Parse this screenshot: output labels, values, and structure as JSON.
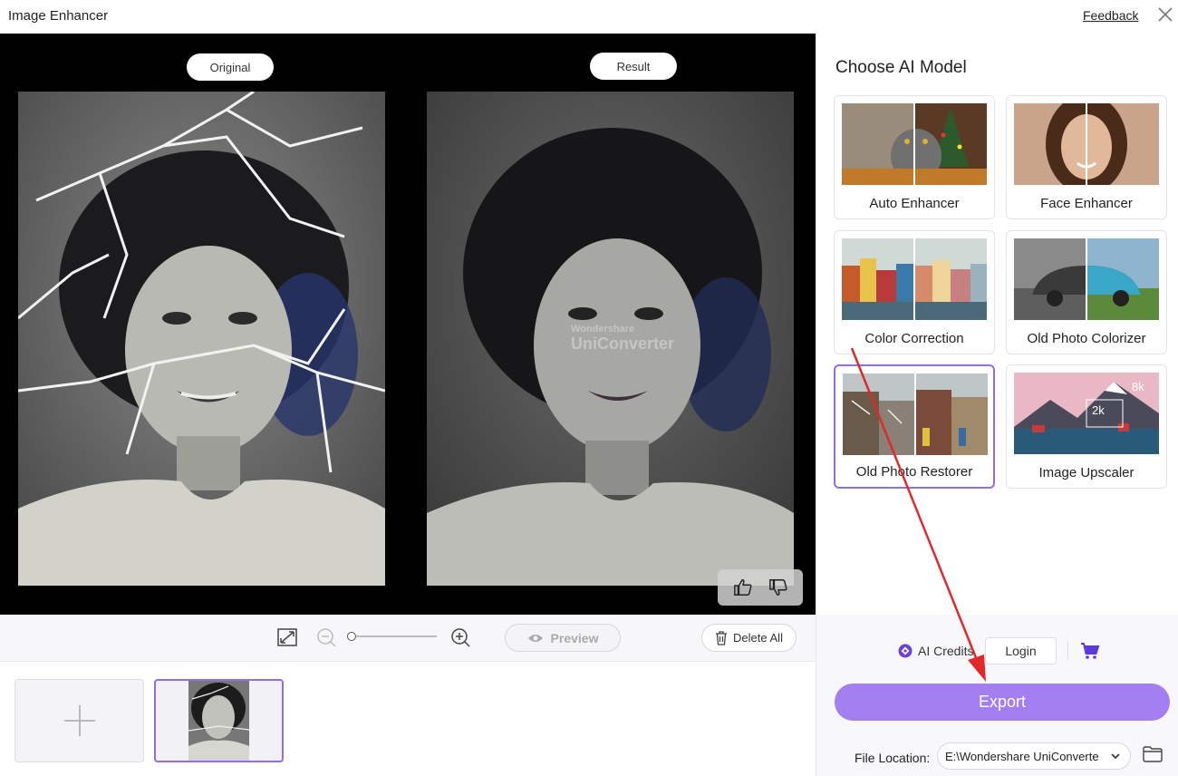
{
  "window": {
    "title": "Image Enhancer",
    "feedback": "Feedback"
  },
  "stage": {
    "original_label": "Original",
    "result_label": "Result",
    "watermark_line1": "Wondershare",
    "watermark_line2": "UniConverter"
  },
  "toolbar": {
    "preview_label": "Preview",
    "delete_all_label": "Delete All",
    "zoom_level": 0
  },
  "panel": {
    "title": "Choose AI Model",
    "models": [
      {
        "label": "Auto Enhancer",
        "selected": false
      },
      {
        "label": "Face Enhancer",
        "selected": false
      },
      {
        "label": "Color Correction",
        "selected": false
      },
      {
        "label": "Old Photo Colorizer",
        "selected": false
      },
      {
        "label": "Old Photo Restorer",
        "selected": true
      },
      {
        "label": "Image Upscaler",
        "selected": false
      }
    ],
    "upscaler_badges": [
      "2k",
      "8k"
    ],
    "ai_credits": "AI Credits",
    "login": "Login",
    "export": "Export",
    "file_location_label": "File Location:",
    "file_location_value": "E:\\Wondershare UniConverte"
  },
  "colors": {
    "accent": "#8f6ee8",
    "export": "#a27ef0",
    "arrow": "#e02a2a"
  }
}
